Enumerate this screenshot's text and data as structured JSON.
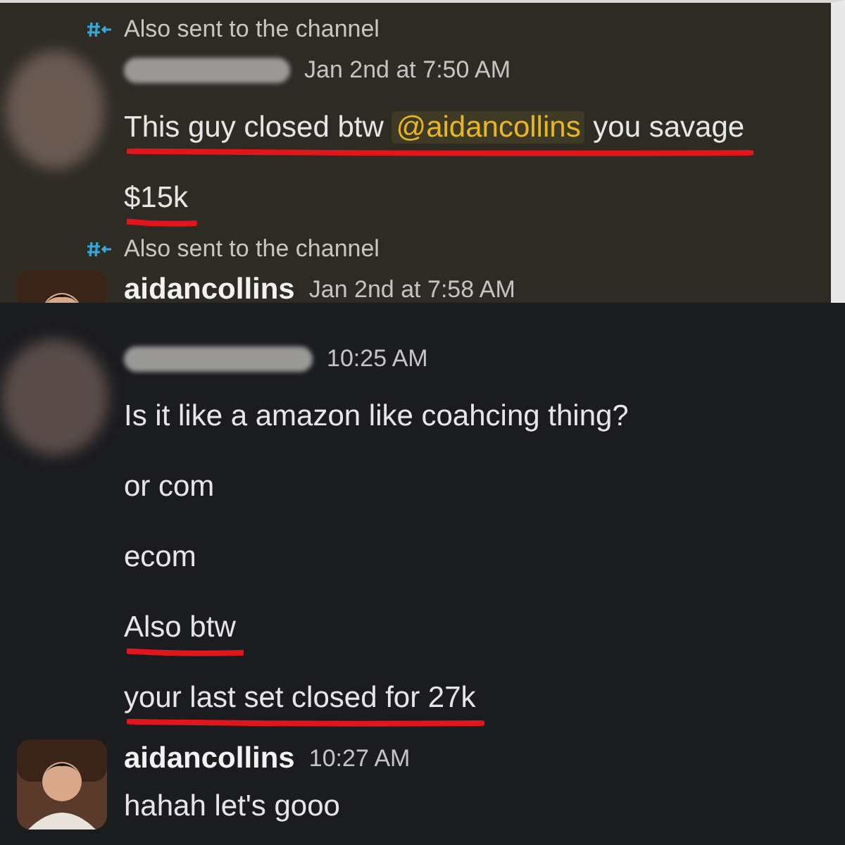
{
  "panels": [
    {
      "kind": "thread",
      "messages": [
        {
          "also_sent": "Also sent to the channel",
          "time": "Jan 2nd at 7:50 AM",
          "lines": [
            {
              "underlined": true,
              "parts": [
                {
                  "kind": "plain",
                  "text": "This guy closed btw "
                },
                {
                  "kind": "mention",
                  "text": "@aidancollins"
                },
                {
                  "kind": "plain",
                  "text": " you savage"
                }
              ]
            },
            {
              "underlined": true,
              "parts": [
                {
                  "kind": "plain",
                  "text": "$15k"
                }
              ]
            }
          ]
        },
        {
          "also_sent": "Also sent to the channel",
          "sender": "aidancollins",
          "time": "Jan 2nd at 7:58 AM"
        }
      ]
    },
    {
      "kind": "channel",
      "messages": [
        {
          "time": "10:25 AM",
          "lines": [
            {
              "underlined": false,
              "parts": [
                {
                  "kind": "plain",
                  "text": "Is it like a amazon like coahcing thing?"
                }
              ]
            },
            {
              "underlined": false,
              "parts": [
                {
                  "kind": "plain",
                  "text": "or com"
                }
              ]
            },
            {
              "underlined": false,
              "parts": [
                {
                  "kind": "plain",
                  "text": "ecom"
                }
              ]
            },
            {
              "underlined": true,
              "parts": [
                {
                  "kind": "plain",
                  "text": "Also btw"
                }
              ]
            },
            {
              "underlined": true,
              "parts": [
                {
                  "kind": "plain",
                  "text": "your last set closed for 27k"
                }
              ]
            }
          ]
        },
        {
          "sender": "aidancollins",
          "time": "10:27 AM",
          "lines": [
            {
              "underlined": false,
              "parts": [
                {
                  "kind": "plain",
                  "text": "hahah let's gooo"
                }
              ]
            }
          ]
        }
      ]
    }
  ]
}
